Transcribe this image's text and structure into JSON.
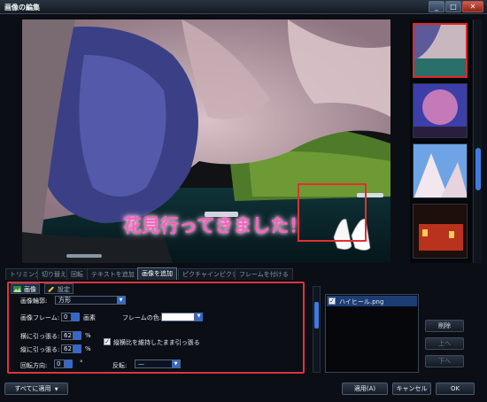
{
  "window": {
    "title": "画像の編集",
    "buttons": [
      "_",
      "□",
      "✕"
    ]
  },
  "preview": {
    "overlay_text": "花見行ってきました！"
  },
  "tabs": [
    {
      "label": "トリミング"
    },
    {
      "label": "切り替え"
    },
    {
      "label": "回転"
    },
    {
      "label": "テキストを追加"
    },
    {
      "label": "画像を追加"
    },
    {
      "label": "ピクチャインピクチャ"
    },
    {
      "label": "フレームを付ける"
    }
  ],
  "settings": {
    "subtabs": [
      "画像",
      "設定"
    ],
    "frame_shape_label": "画像輪郭:",
    "frame_shape_value": "方形",
    "frame_label": "画像フレーム:",
    "frame_value": "0",
    "frame_unit": "画素",
    "frame_color_label": "フレームの色:",
    "stretch_w_label": "横に引っ張る:",
    "stretch_w_value": "62",
    "stretch_h_label": "縦に引っ張る:",
    "stretch_h_value": "62",
    "percent": "%",
    "keep_aspect_label": "縦横比を維持したまま引っ張る",
    "keep_aspect_checked": "✓",
    "rotate_label": "回転方向:",
    "rotate_value": "0",
    "rotate_unit": "°",
    "flip_label": "反転:",
    "flip_value": "—"
  },
  "layers": {
    "items": [
      {
        "name": "ハイヒール.png",
        "checked": "✓"
      }
    ]
  },
  "side_buttons": {
    "delete": "削除",
    "up": "上へ",
    "down": "下へ"
  },
  "bottom": {
    "apply_all": "すべてに適用",
    "apply": "適用(A)",
    "cancel": "キャンセル",
    "ok": "OK"
  },
  "colors": {
    "accent": "#3868c4",
    "highlight_red": "#e02828",
    "overlay_text": "#ff5fc0",
    "background": "#0b0e14"
  }
}
